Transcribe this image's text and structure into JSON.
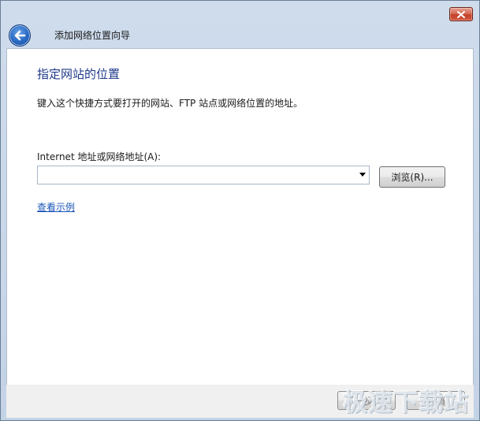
{
  "window": {
    "title": "添加网络位置向导",
    "close_icon": "close-icon",
    "back_icon": "back-arrow-icon"
  },
  "page": {
    "heading": "指定网站的位置",
    "description": "键入这个快捷方式要打开的网站、FTP 站点或网络位置的地址。",
    "field_label": "Internet 地址或网络地址(A):",
    "address_value": "",
    "address_placeholder": "",
    "browse_label": "浏览(R)...",
    "example_link": "查看示例"
  },
  "footer": {
    "next_label": "下一步(N)",
    "cancel_label": "取消"
  },
  "watermark": "极速下载站",
  "colors": {
    "heading": "#1e3a8a",
    "link": "#1a55b8",
    "title_bar": "#c3d3e6",
    "close_button": "#c43f29"
  }
}
